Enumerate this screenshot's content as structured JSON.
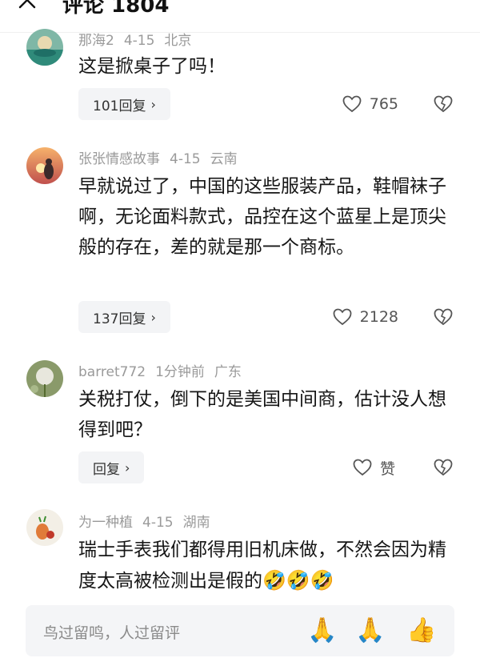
{
  "header": {
    "title": "评论 1804"
  },
  "comments": [
    {
      "user": "那海2",
      "date": "4-15",
      "location": "北京",
      "text": "这是掀桌子了吗！",
      "reply_label": "101回复",
      "likes": "765"
    },
    {
      "user": "张张情感故事",
      "date": "4-15",
      "location": "云南",
      "text": "早就说过了，中国的这些服装产品，鞋帽袜子啊，无论面料款式，品控在这个蓝星上是顶尖般的存在，差的就是那一个商标。",
      "reply_label": "137回复",
      "likes": "2128"
    },
    {
      "user": "barret772",
      "date": "1分钟前",
      "location": "广东",
      "text": "关税打仗，倒下的是美国中间商，估计没人想得到吧？",
      "reply_label": "回复",
      "likes": "赞"
    },
    {
      "user": "为一种植",
      "date": "4-15",
      "location": "湖南",
      "text": "瑞士手表我们都得用旧机床做，不然会因为精度太高被检测出是假的",
      "emojis": "🤣🤣🤣"
    }
  ],
  "bottom": {
    "placeholder": "鸟过留鸣，人过留评",
    "emoji_1": "🙏",
    "emoji_2": "🙏",
    "emoji_3": "👍"
  }
}
